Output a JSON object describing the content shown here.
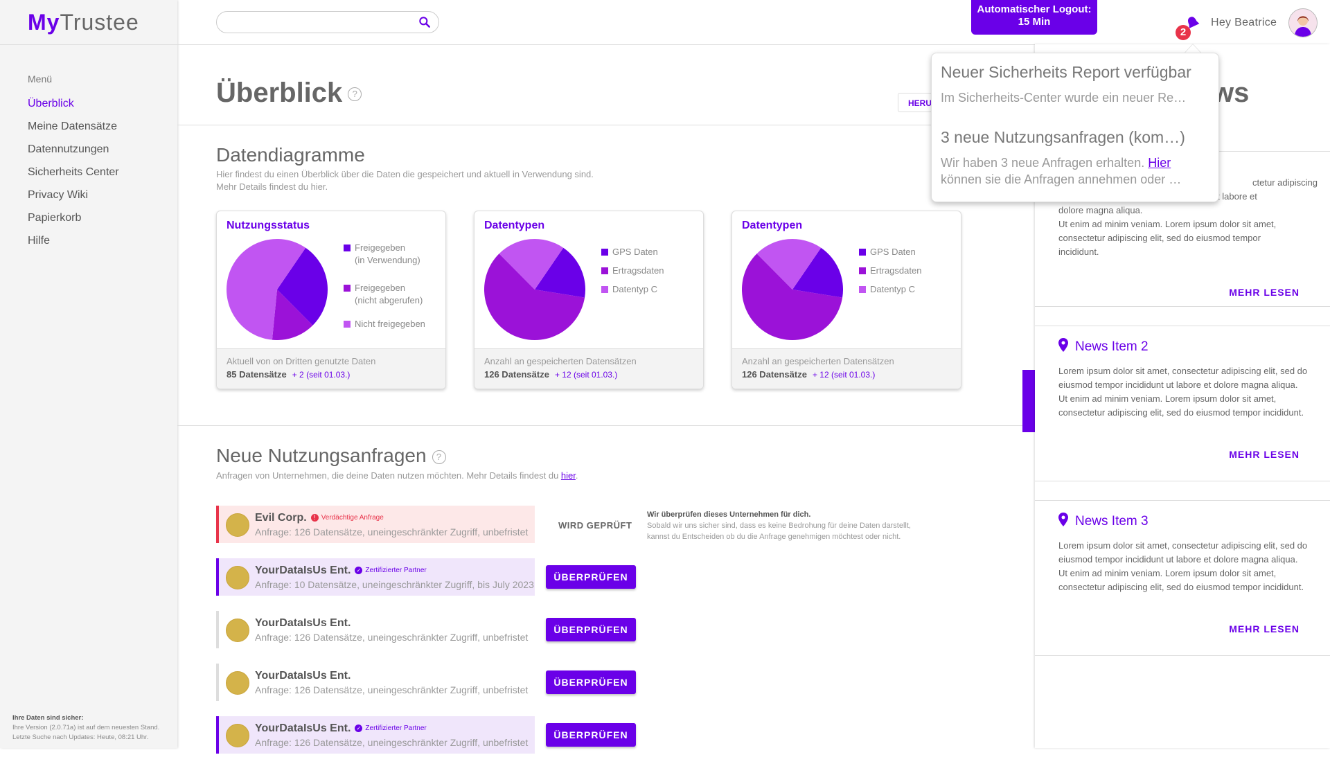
{
  "app": {
    "brand_bold": "My",
    "brand_rest": "Trustee"
  },
  "sidebar": {
    "menu_heading": "Menü",
    "items": [
      {
        "label": "Überblick",
        "active": true
      },
      {
        "label": "Meine Datensätze"
      },
      {
        "label": "Datennutzungen"
      },
      {
        "label": "Sicherheits Center"
      },
      {
        "label": "Privacy Wiki"
      },
      {
        "label": "Papierkorb"
      },
      {
        "label": "Hilfe"
      }
    ],
    "footer": {
      "title": "Ihre Daten sind sicher:",
      "line1": "Ihre Version (2.0.71a) ist auf dem neuesten Stand.",
      "line2": "Letzte Suche nach Updates: Heute, 08:21 Uhr."
    }
  },
  "header": {
    "search": {
      "value": "",
      "placeholder": ""
    },
    "logout_line1": "Automatischer Logout:",
    "logout_line2": "15 Min",
    "notification_count": "2",
    "greeting": "Hey Beatrice"
  },
  "main": {
    "title": "Überblick",
    "help_glyph": "?",
    "heru_button": "HERU",
    "diagrams": {
      "title": "Datendiagramme",
      "sub1": "Hier findest du einen Überblick über die Daten die gespeichert und aktuell in Verwendung sind.",
      "sub2": "Mehr Details findest du hier."
    },
    "cards": [
      {
        "title": "Nutzungsstatus",
        "legend": [
          {
            "label1": "Freigegeben",
            "label2": "(in Verwendung)",
            "color": "#6a00e8"
          },
          {
            "label1": "Freigegeben",
            "label2": "(nicht abgerufen)",
            "color": "#9b12d8"
          },
          {
            "label1": "Nicht freigegeben",
            "label2": "",
            "color": "#c155f2"
          }
        ],
        "slices": [
          0.28,
          0.14,
          0.58
        ],
        "footer_label": "Aktuell von on Dritten genutzte Daten",
        "footer_value": "85 Datensätze",
        "footer_delta": "+ 2 (seit 01.03.)"
      },
      {
        "title": "Datentypen",
        "legend": [
          {
            "label1": "GPS Daten",
            "label2": "",
            "color": "#6a00e8"
          },
          {
            "label1": "Ertragsdaten",
            "label2": "",
            "color": "#9b12d8"
          },
          {
            "label1": "Datentyp C",
            "label2": "",
            "color": "#c155f2"
          }
        ],
        "slices": [
          0.18,
          0.6,
          0.22
        ],
        "footer_label": "Anzahl an gespeicherten Datensätzen",
        "footer_value": "126 Datensätze",
        "footer_delta": "+ 12 (seit 01.03.)"
      },
      {
        "title": "Datentypen",
        "legend": [
          {
            "label1": "GPS Daten",
            "label2": "",
            "color": "#6a00e8"
          },
          {
            "label1": "Ertragsdaten",
            "label2": "",
            "color": "#9b12d8"
          },
          {
            "label1": "Datentyp C",
            "label2": "",
            "color": "#c155f2"
          }
        ],
        "slices": [
          0.18,
          0.6,
          0.22
        ],
        "footer_label": "Anzahl an gespeicherten Datensätzen",
        "footer_value": "126 Datensätze",
        "footer_delta": "+ 12 (seit 01.03.)"
      }
    ],
    "requests": {
      "title": "Neue Nutzungsanfragen",
      "sub_pre": "Anfragen von Unternehmen, die deine Daten nutzen möchten. Mehr Details findest du ",
      "sub_link": "hier",
      "sub_post": ".",
      "items": [
        {
          "name": "Evil Corp.",
          "tag": "Verdächtige Anfrage",
          "desc": "Anfrage: 126 Datensätze, uneingeschränkter Zugriff, unbefristet",
          "kind": "warn"
        },
        {
          "name": "YourDataIsUs Ent.",
          "tag": "Zertifizierter Partner",
          "desc": "Anfrage: 10 Datensätze, uneingeschränkter Zugriff, bis July 2023",
          "kind": "cert",
          "button": "ÜBERPRÜFEN"
        },
        {
          "name": "YourDataIsUs Ent.",
          "tag": "",
          "desc": "Anfrage: 126 Datensätze, uneingeschränkter Zugriff, unbefristet",
          "kind": "plain",
          "button": "ÜBERPRÜFEN"
        },
        {
          "name": "YourDataIsUs Ent.",
          "tag": "",
          "desc": "Anfrage: 126 Datensätze, uneingeschränkter Zugriff, unbefristet",
          "kind": "plain",
          "button": "ÜBERPRÜFEN"
        },
        {
          "name": "YourDataIsUs Ent.",
          "tag": "Zertifizierter Partner",
          "desc": "Anfrage: 126 Datensätze, uneingeschränkter Zugriff, unbefristet",
          "kind": "cert",
          "button": "ÜBERPRÜFEN"
        }
      ],
      "checking_label": "WIRD GEPRÜFT",
      "checking_note_title": "Wir überprüfen dieses Unternehmen für dich.",
      "checking_note_line1": "Sobald wir uns sicher sind, dass es keine Bedrohung für deine Daten darstellt,",
      "checking_note_line2": "kannst du Entscheiden ob du die Anfrage genehmigen möchtest oder nicht."
    }
  },
  "news": {
    "title_fragment": "ws",
    "first_text_partial": "ctetur adipiscing",
    "first_text_lines": [
      "elit, sed do eiusmod tempor incididunt ut labore et",
      "dolore magna aliqua.",
      "Ut enim ad minim veniam. Lorem ipsum dolor sit amet,",
      "consectetur adipiscing elit, sed do eiusmod tempor",
      "incididunt."
    ],
    "items": [
      {
        "title": "News Item 2"
      },
      {
        "title": "News Item 3"
      }
    ],
    "body": "Lorem ipsum dolor sit amet, consectetur adipiscing elit, sed do eiusmod tempor incididunt ut labore et dolore magna aliqua.\nUt enim ad minim veniam. Lorem ipsum dolor sit amet, consectetur adipiscing elit, sed do eiusmod tempor incididunt.",
    "more_label": "MEHR LESEN"
  },
  "notifications": [
    {
      "title": "Neuer Sicherheits Report verfügbar",
      "text": "Im Sicherheits-Center wurde ein neuer Re…"
    },
    {
      "title": "3 neue Nutzungsanfragen (kom…)",
      "text_pre": "Wir haben 3 neue Anfragen erhalten. ",
      "text_link": "Hier",
      "text_post": "",
      "text_line2": "können sie die Anfragen annehmen oder …"
    }
  ],
  "colors": {
    "accent": "#6a00e8",
    "warn": "#e8334a"
  }
}
